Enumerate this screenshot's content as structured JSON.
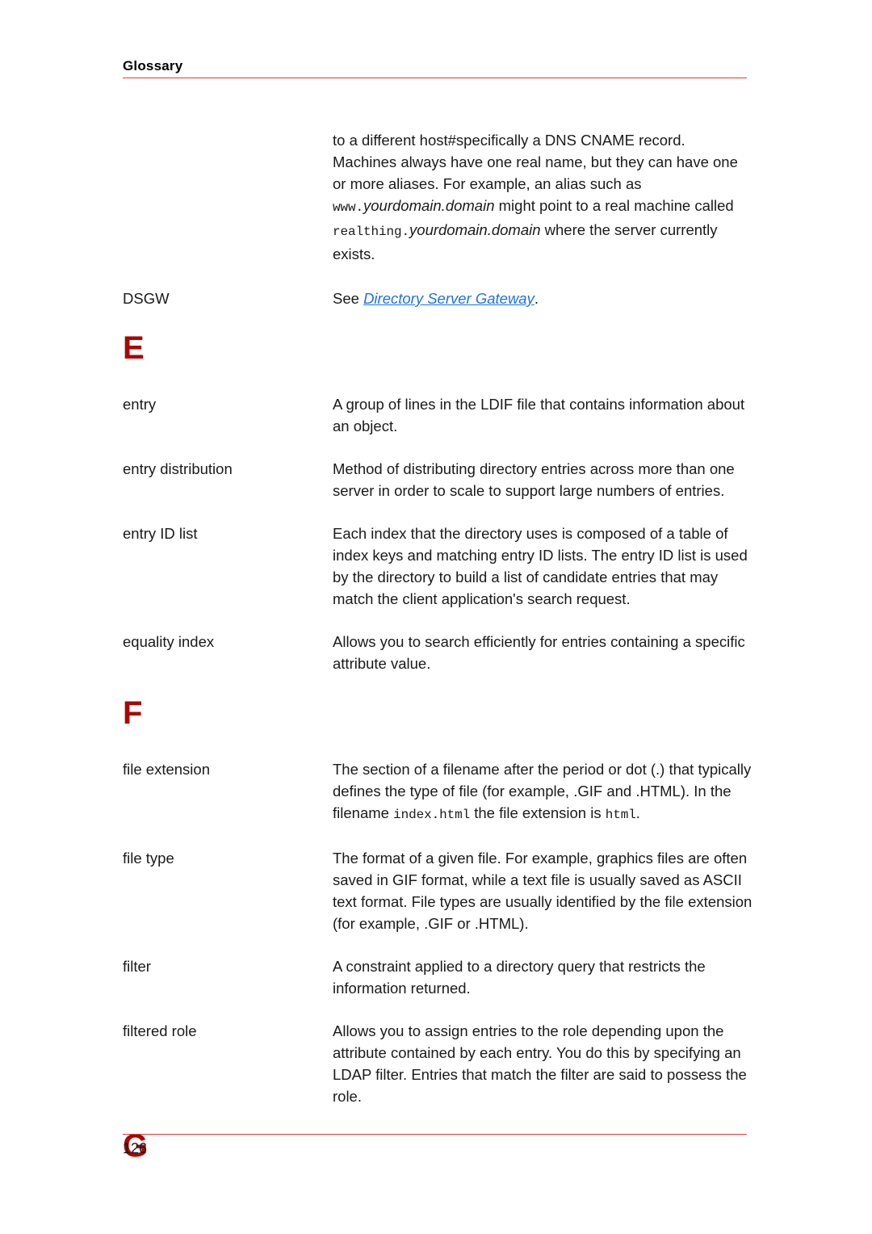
{
  "header": {
    "running_title": "Glossary",
    "rule_color": "#d83b3b"
  },
  "intro_paragraph": {
    "segments": [
      {
        "text": "to a different host#specifically a DNS CNAME record. Machines always have one real name, but they can have one or more aliases. For example, an alias such as ",
        "style": "normal"
      },
      {
        "text": "www.",
        "style": "mono"
      },
      {
        "text": "yourdomain.domain",
        "style": "italic"
      },
      {
        "text": " might point to a real machine called ",
        "style": "normal"
      },
      {
        "text": "realthing.",
        "style": "mono"
      },
      {
        "text": "yourdomain.domain",
        "style": "italic"
      },
      {
        "text": " where the server currently exists.",
        "style": "normal"
      }
    ]
  },
  "dsgw_entry": {
    "term": "DSGW",
    "see_label": "See ",
    "xref": "Directory Server Gateway",
    "trailing": "."
  },
  "sections": [
    {
      "letter": "E",
      "letter_color": "#aa0606",
      "entries": [
        {
          "term": "entry",
          "definition": "A group of lines in the LDIF file that contains information about an object."
        },
        {
          "term": "entry distribution",
          "definition": "Method of distributing directory entries across more than one server in order to scale to support large numbers of entries."
        },
        {
          "term": "entry ID list",
          "definition": "Each index that the directory uses is composed of a table of index keys and matching entry ID lists. The entry ID list is used by the directory to build a list of candidate entries that may match the client application's search request."
        },
        {
          "term": "equality index",
          "definition": "Allows you to search efficiently for entries containing a specific attribute value."
        }
      ]
    },
    {
      "letter": "F",
      "letter_color": "#aa0606",
      "entries": [
        {
          "term": "file extension",
          "definition_segments": [
            {
              "text": "The section of a filename after the period or dot (.) that typically defines the type of file (for example, .GIF and .HTML). In the filename ",
              "style": "normal"
            },
            {
              "text": "index.html",
              "style": "mono"
            },
            {
              "text": " the file extension is ",
              "style": "normal"
            },
            {
              "text": "html",
              "style": "mono"
            },
            {
              "text": ".",
              "style": "normal"
            }
          ]
        },
        {
          "term": "file type",
          "definition": "The format of a given file. For example, graphics files are often saved in GIF format, while a text file is usually saved as ASCII text format. File types are usually identified by the file extension (for example, .GIF or .HTML)."
        },
        {
          "term": "filter",
          "definition": "A constraint applied to a directory query that restricts the information returned."
        },
        {
          "term": "filtered role",
          "definition": "Allows you to assign entries to the role depending upon the attribute contained by each entry. You do this by specifying an LDAP filter. Entries that match the filter are said to possess the role."
        }
      ]
    },
    {
      "letter": "G",
      "letter_color": "#aa0606",
      "entries": []
    }
  ],
  "footer": {
    "page_number": "126",
    "rule_color": "#d83b3b"
  }
}
